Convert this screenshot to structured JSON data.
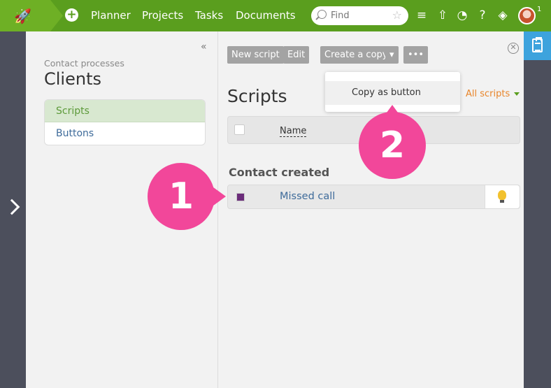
{
  "nav": {
    "items": [
      "Planner",
      "Projects",
      "Tasks",
      "Documents"
    ],
    "search_placeholder": "Find",
    "notif_count": "1"
  },
  "sidebar": {
    "crumb": "Contact processes",
    "title": "Clients",
    "items": [
      {
        "label": "Scripts",
        "active": true
      },
      {
        "label": "Buttons",
        "active": false
      }
    ]
  },
  "toolbar": {
    "new_script": "New script",
    "edit": "Edit",
    "create_copy": "Create a copy",
    "dropdown_arrow": "▾",
    "more": "•••"
  },
  "dropdown": {
    "option": "Copy as button"
  },
  "main": {
    "heading": "Scripts",
    "filter": "All scripts",
    "column_name": "Name",
    "group": "Contact created",
    "rows": [
      {
        "label": "Missed call",
        "color": "#6b2c7a"
      }
    ]
  },
  "callouts": [
    "1",
    "2"
  ],
  "colors": {
    "topbar": "#5a9e1e",
    "accent_pink": "#f2479a",
    "rail": "#4c4f5c",
    "blue_tab": "#3da3dd"
  }
}
